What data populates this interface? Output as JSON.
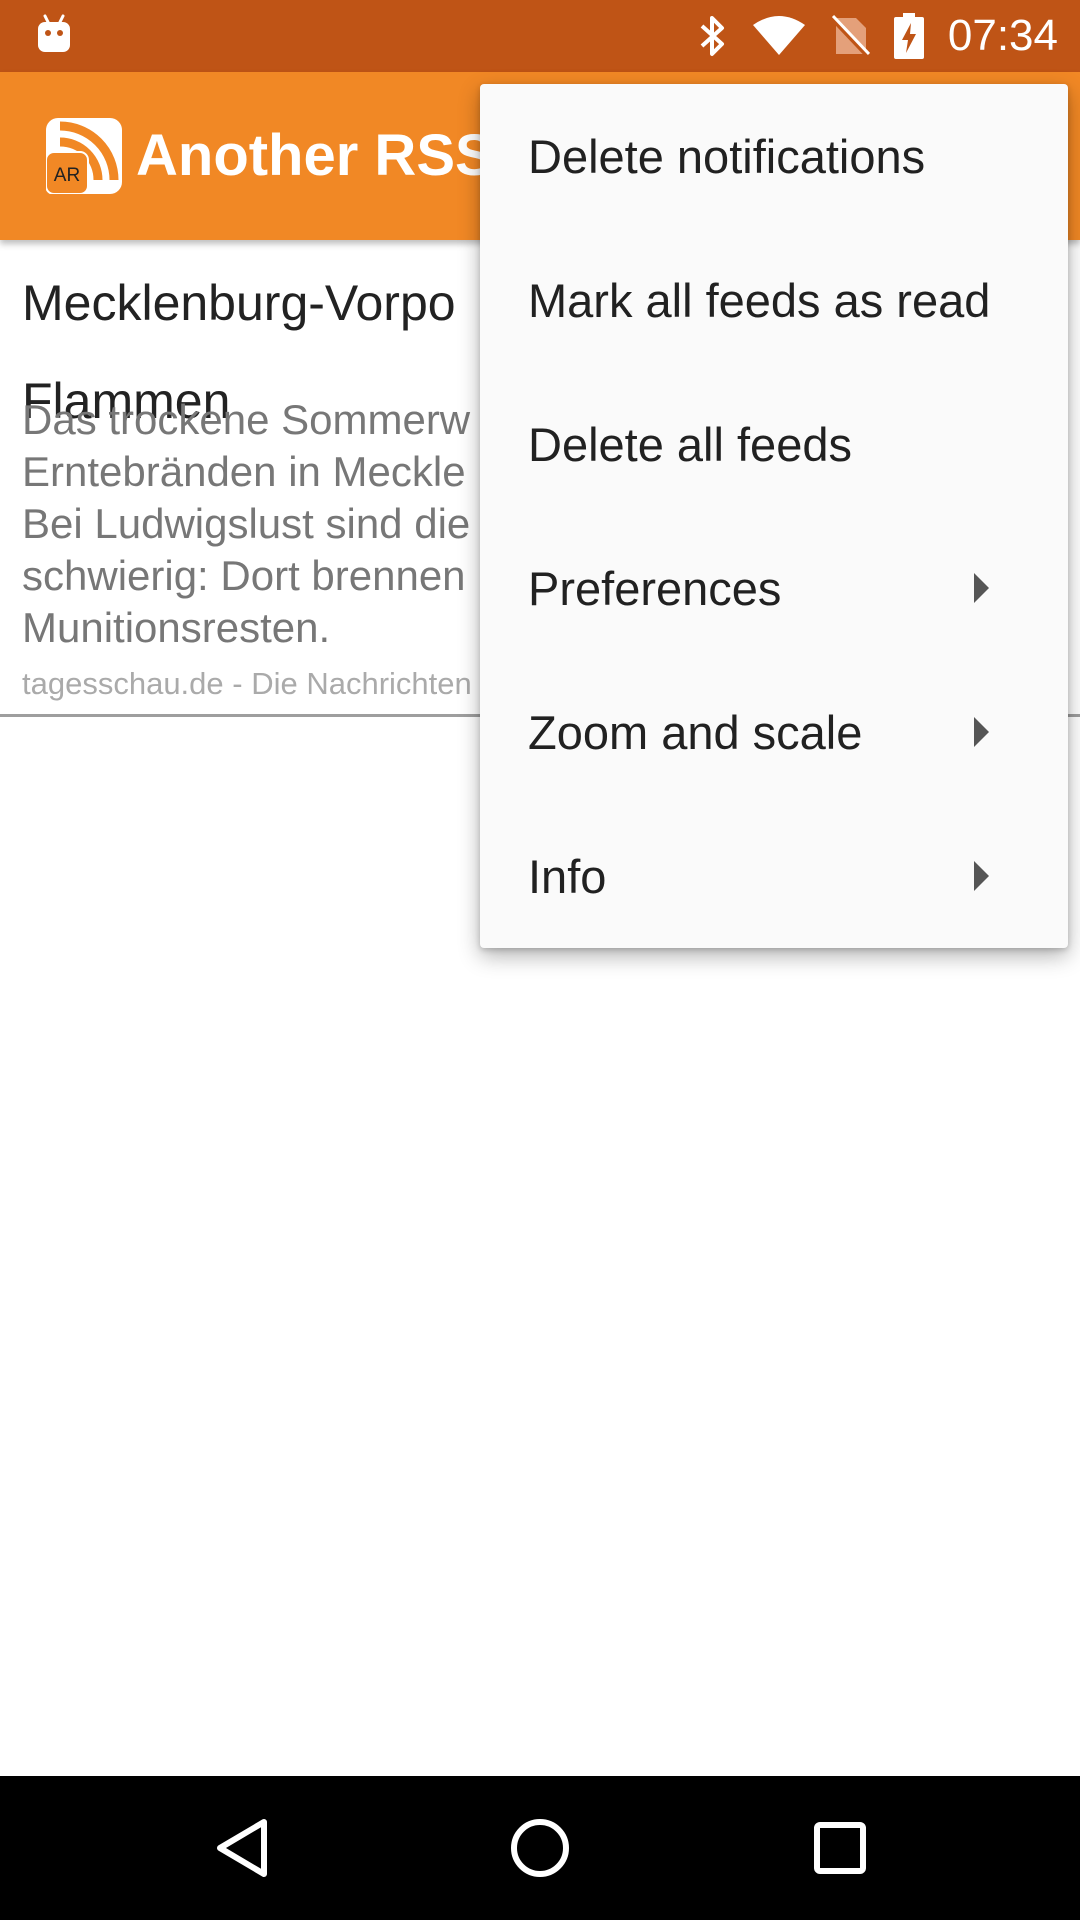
{
  "status_bar": {
    "time": "07:34",
    "icons": [
      "android-notification-icon",
      "bluetooth-icon",
      "wifi-icon",
      "no-sim-icon",
      "battery-charging-icon"
    ],
    "background": "#bf5416"
  },
  "app_bar": {
    "title": "Another RSS",
    "logo_text": "AR",
    "background": "#f18825"
  },
  "feed_item": {
    "title_lines": [
      "Mecklenburg-Vorpo",
      "Flammen"
    ],
    "description_lines": [
      "Das trockene Sommerw",
      "Erntebränden in Meckle",
      "Bei Ludwigslust sind die",
      "schwierig: Dort brennen",
      "Munitionsresten."
    ],
    "source": "tagesschau.de - Die Nachrichten"
  },
  "menu": {
    "items": [
      {
        "label": "Delete notifications",
        "has_submenu": false
      },
      {
        "label": "Mark all feeds as read",
        "has_submenu": false
      },
      {
        "label": "Delete all feeds",
        "has_submenu": false
      },
      {
        "label": "Preferences",
        "has_submenu": true
      },
      {
        "label": "Zoom and scale",
        "has_submenu": true
      },
      {
        "label": "Info",
        "has_submenu": true
      }
    ]
  },
  "nav_bar": {
    "buttons": [
      "back-icon",
      "home-icon",
      "recents-icon"
    ]
  }
}
